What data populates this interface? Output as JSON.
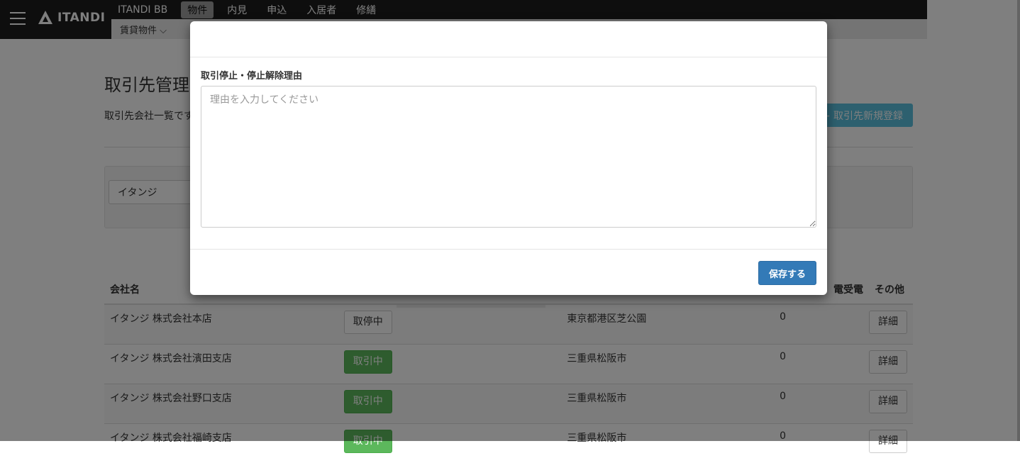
{
  "header": {
    "logo_text": "ITANDI",
    "nav_tabs": [
      "ITANDI BB",
      "物件",
      "内見",
      "申込",
      "入居者",
      "修繕"
    ],
    "active_tab": "物件",
    "subnav_item": "賃貸物件 ⌵"
  },
  "page": {
    "title": "取引先管理",
    "description": "取引先会社一覧です",
    "register_button": "+ 取引先新規登録",
    "search_value": "イタンジ"
  },
  "table": {
    "headers": {
      "company": "会社名",
      "incoming": "電受電",
      "other": "その他"
    },
    "rows": [
      {
        "company": "イタンジ 株式会社本店",
        "status": "取停中",
        "address": "東京都港区芝公園",
        "count": "0",
        "detail": "詳細"
      },
      {
        "company": "イタンジ 株式会社濱田支店",
        "status": "取引中",
        "address": "三重県松阪市",
        "count": "0",
        "detail": "詳細"
      },
      {
        "company": "イタンジ 株式会社野口支店",
        "status": "取引中",
        "address": "三重県松阪市",
        "count": "0",
        "detail": "詳細"
      },
      {
        "company": "イタンジ 株式会社福崎支店",
        "status": "取引中",
        "address": "三重県松阪市",
        "count": "0",
        "detail": "詳細"
      }
    ]
  },
  "modal": {
    "field_label": "取引停止・停止解除理由",
    "textarea_placeholder": "理由を入力してください",
    "textarea_value": "",
    "save_button": "保存する"
  },
  "colors": {
    "primary": "#337ab7",
    "success": "#5cb85c",
    "info": "#5bc0de",
    "header_bg": "#1c1c1c"
  }
}
